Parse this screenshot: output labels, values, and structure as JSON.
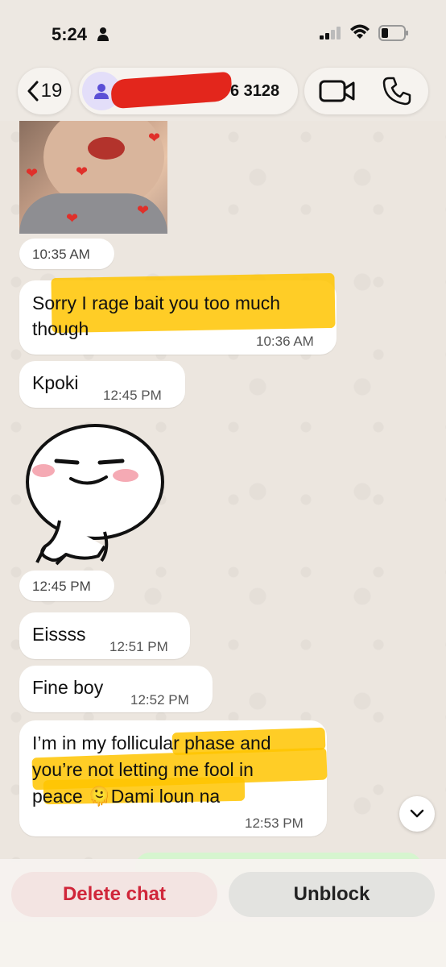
{
  "status_bar": {
    "time": "5:24"
  },
  "header": {
    "back_count": "19",
    "contact_name_visible": "6 3128"
  },
  "messages": [
    {
      "type": "image",
      "time": "10:35 AM"
    },
    {
      "type": "text",
      "text_line1": "Sorry I rage bait you too much",
      "text_line2": "though",
      "time": "10:36 AM"
    },
    {
      "type": "text",
      "text": "Kpoki",
      "time": "12:45 PM"
    },
    {
      "type": "sticker",
      "time": "12:45 PM"
    },
    {
      "type": "text",
      "text": "Eissss",
      "time": "12:51 PM"
    },
    {
      "type": "text",
      "text": "Fine boy",
      "time": "12:52 PM"
    },
    {
      "type": "text",
      "text_line1": "I’m in my follicular phase and",
      "text_line2": "you’re not letting me fool in",
      "text_line3": "peace 🫠Dami loun na",
      "time": "12:53 PM"
    }
  ],
  "bottom_bar": {
    "delete_label": "Delete chat",
    "unblock_label": "Unblock"
  },
  "colors": {
    "highlight": "#ffc400",
    "delete": "#d0263a",
    "avatar_bg": "#e3def9",
    "accent_purple": "#5b4fd6"
  },
  "icons": [
    "person-icon",
    "signal-icon",
    "wifi-icon",
    "battery-icon",
    "chevron-left-icon",
    "avatar-icon",
    "video-icon",
    "phone-icon",
    "chevron-down-icon"
  ]
}
